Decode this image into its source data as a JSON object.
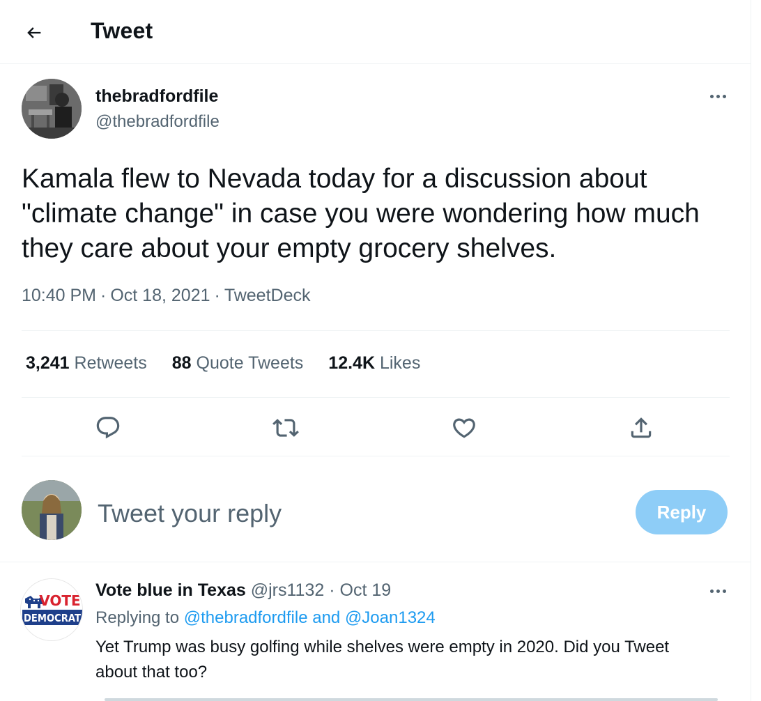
{
  "header": {
    "title": "Tweet"
  },
  "tweet": {
    "author_name": "thebradfordfile",
    "author_handle": "@thebradfordfile",
    "text": "Kamala flew to Nevada today for a discussion about \"climate change\" in case you were wondering how much they care about your empty grocery shelves.",
    "time": "10:40 PM",
    "date": "Oct 18, 2021",
    "source": "TweetDeck",
    "separator": "·"
  },
  "stats": {
    "retweets_count": "3,241",
    "retweets_label": "Retweets",
    "quotes_count": "88",
    "quotes_label": "Quote Tweets",
    "likes_count": "12.4K",
    "likes_label": "Likes"
  },
  "icons": {
    "back": "arrow-left-icon",
    "more": "more-horizontal-icon",
    "reply": "comment-icon",
    "retweet": "retweet-icon",
    "like": "heart-icon",
    "share": "share-icon"
  },
  "composer": {
    "placeholder": "Tweet your reply",
    "button_label": "Reply"
  },
  "reply": {
    "author_name": "Vote blue in Texas",
    "author_handle": "@jrs1132",
    "separator": "·",
    "date": "Oct 19",
    "replying_prefix": "Replying to",
    "replying_to_1": "@thebradfordfile",
    "replying_and": "and",
    "replying_to_2": "@Joan1324",
    "text": "Yet Trump was busy golfing while shelves were empty in 2020. Did you Tweet about that too?",
    "avatar_text_top": "VOTE",
    "avatar_text_bottom": "DEMOCRAT"
  },
  "colors": {
    "text": "#0f1419",
    "secondary": "#536471",
    "link": "#1d9bf0",
    "reply_button": "#8ecdf7",
    "border": "#eff3f4"
  }
}
